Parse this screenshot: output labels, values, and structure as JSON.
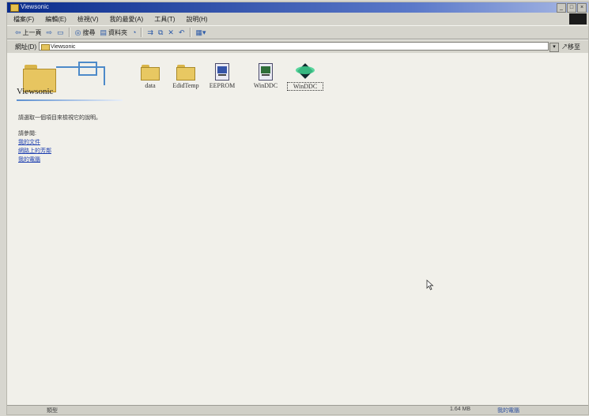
{
  "window": {
    "title": "Viewsonic",
    "controls": [
      "minimize",
      "maximize",
      "close"
    ]
  },
  "menu": [
    "檔案(F)",
    "編輯(E)",
    "檢視(V)",
    "我的最愛(A)",
    "工具(T)",
    "說明(H)"
  ],
  "toolbar": {
    "back_label": "上一頁",
    "search_label": "搜尋",
    "folders_label": "資料夾",
    "icons": [
      "back-arrow",
      "forward-arrow",
      "up-folder",
      "search",
      "folders",
      "history",
      "move-to",
      "copy-to",
      "delete",
      "undo",
      "views"
    ]
  },
  "address": {
    "label": "網址(D)",
    "value": "Viewsonic",
    "go_label": "移至"
  },
  "left_panel": {
    "title": "Viewsonic",
    "description": "請選取一個項目來檢視它的說明。",
    "see_also_label": "請參閱:",
    "links": [
      "我的文件",
      "網路上的芳鄰",
      "我的電腦"
    ]
  },
  "items": [
    {
      "name": "data",
      "type": "folder"
    },
    {
      "name": "EdidTemp",
      "type": "folder"
    },
    {
      "name": "EEPROM",
      "type": "file"
    },
    {
      "name": "WinDDC",
      "type": "file"
    },
    {
      "name": "WinDDC",
      "type": "app",
      "selected": true
    }
  ],
  "status": {
    "left_text": "類型",
    "size": "1.64 MB",
    "location": "我的電腦"
  }
}
